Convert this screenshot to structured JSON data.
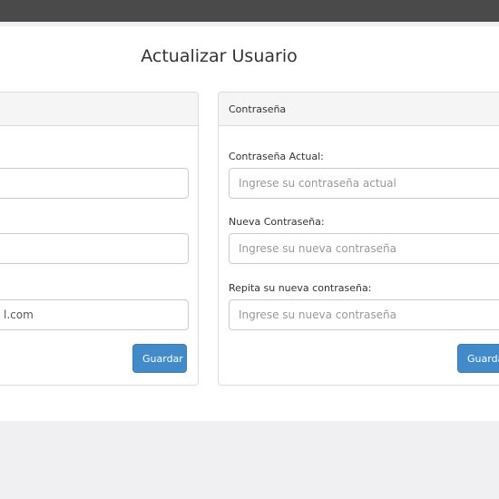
{
  "page": {
    "title": "Actualizar Usuario"
  },
  "left_panel": {
    "heading": "",
    "fields": [
      {
        "value": ""
      },
      {
        "value": ""
      },
      {
        "value": "l.com"
      }
    ],
    "save_label": "Guardar"
  },
  "password_panel": {
    "heading": "Contraseña",
    "current": {
      "label": "Contraseña Actual:",
      "placeholder": "Ingrese su contraseña actual"
    },
    "new": {
      "label": "Nueva Contraseña:",
      "placeholder": "Ingrese su nueva contraseña"
    },
    "repeat": {
      "label": "Repita su nueva contraseña:",
      "placeholder": "Ingrese su nueva contraseña"
    },
    "save_label": "Guardar"
  },
  "colors": {
    "accent": "#428bca",
    "topbar": "#4a4a4a",
    "background": "#f0f0f2"
  }
}
